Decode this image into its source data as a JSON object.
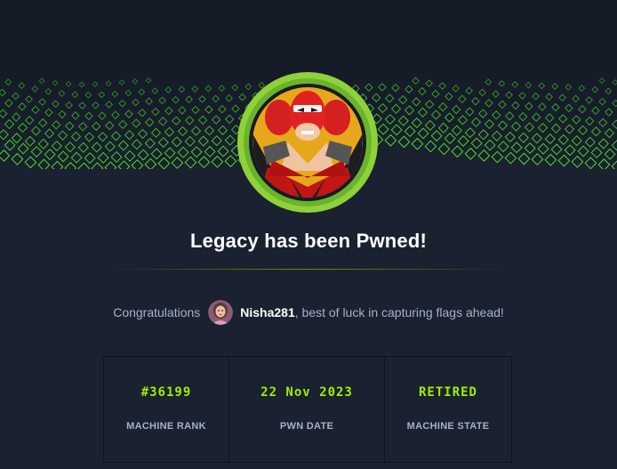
{
  "header": {
    "title": "Legacy has been Pwned!"
  },
  "congrats": {
    "prefix": "Congratulations",
    "username": "Nisha281",
    "suffix": ", best of luck in capturing flags ahead!"
  },
  "stats": [
    {
      "value": "#36199",
      "label": "MACHINE RANK"
    },
    {
      "value": "22 Nov 2023",
      "label": "PWN DATE"
    },
    {
      "value": "RETIRED",
      "label": "MACHINE STATE"
    }
  ],
  "colors": {
    "background": "#1a2130",
    "accent": "#9fef00",
    "muted_text": "#a4b1cd"
  },
  "icons": {
    "machine_avatar": "masked-hero-avatar",
    "user_avatar": "user-avatar"
  }
}
